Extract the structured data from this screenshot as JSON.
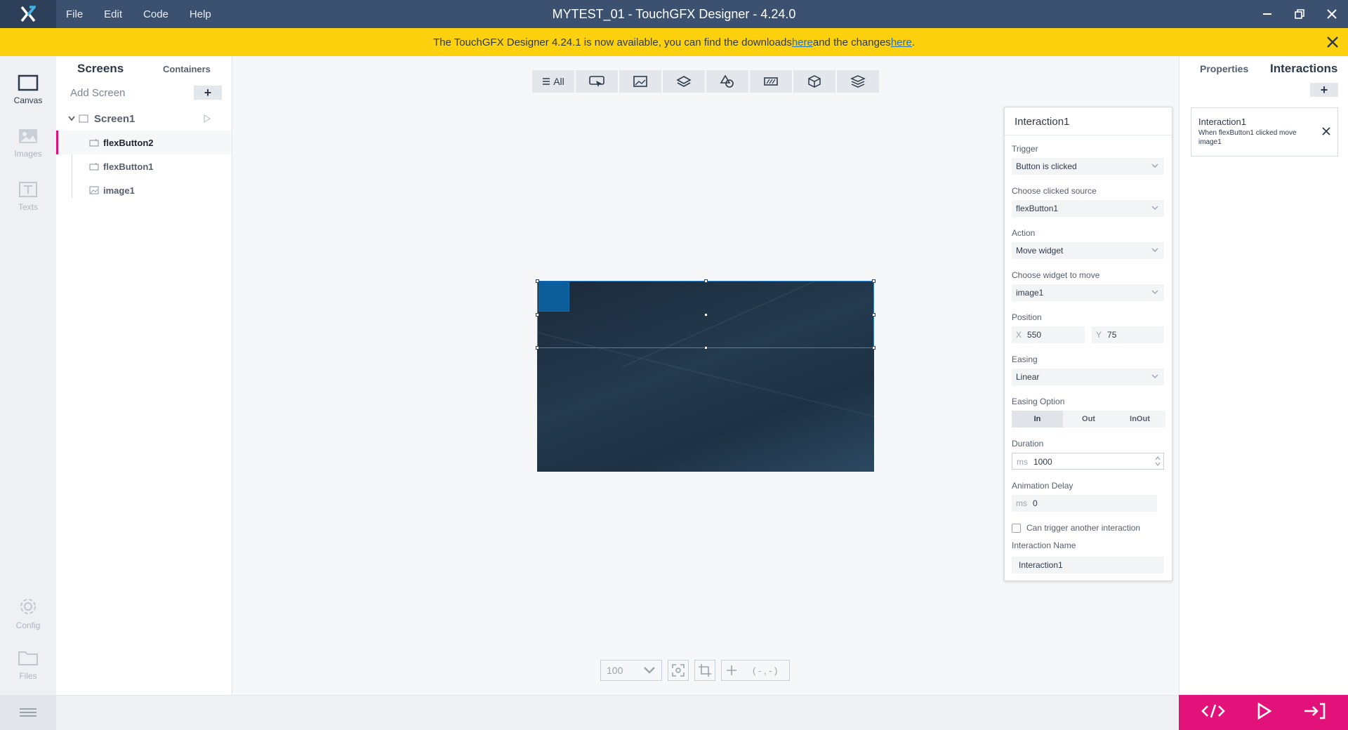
{
  "window": {
    "title": "MYTEST_01 - TouchGFX Designer - 4.24.0"
  },
  "menu": [
    "File",
    "Edit",
    "Code",
    "Help"
  ],
  "notice": {
    "text_before": "The TouchGFX Designer 4.24.1 is now available, you can find the downloads ",
    "link1": "here",
    "text_middle": " and the changes ",
    "link2": "here",
    "text_after": "."
  },
  "rail": {
    "canvas": "Canvas",
    "images": "Images",
    "texts": "Texts",
    "config": "Config",
    "files": "Files"
  },
  "screens_panel": {
    "tab_screens": "Screens",
    "tab_containers": "Containers",
    "add_screen": "Add Screen",
    "add_symbol": "+",
    "screen_name": "Screen1",
    "widgets": [
      "flexButton2",
      "flexButton1",
      "image1"
    ]
  },
  "toolbar": {
    "all_label": "All"
  },
  "zoom": {
    "level": "100",
    "coords": "( - , - )"
  },
  "interaction_detail": {
    "title": "Interaction1",
    "trigger_label": "Trigger",
    "trigger_value": "Button is clicked",
    "source_label": "Choose clicked source",
    "source_value": "flexButton1",
    "action_label": "Action",
    "action_value": "Move widget",
    "widget_label": "Choose widget to move",
    "widget_value": "image1",
    "position_label": "Position",
    "x_prefix": "X",
    "x_value": "550",
    "y_prefix": "Y",
    "y_value": "75",
    "easing_label": "Easing",
    "easing_value": "Linear",
    "easing_option_label": "Easing Option",
    "easing_options": [
      "In",
      "Out",
      "InOut"
    ],
    "duration_label": "Duration",
    "duration_unit": "ms",
    "duration_value": "1000",
    "delay_label": "Animation Delay",
    "delay_unit": "ms",
    "delay_value": "0",
    "chain_label": "Can trigger another interaction",
    "name_label": "Interaction Name",
    "name_value": "Interaction1"
  },
  "right_panel": {
    "tab_properties": "Properties",
    "tab_interactions": "Interactions",
    "add_symbol": "+",
    "card_name": "Interaction1",
    "card_desc": "When flexButton1 clicked move image1"
  },
  "colors": {
    "accent": "#e2127a",
    "titlebar": "#3c5070",
    "notice": "#fdd10d",
    "selection": "#2f8ad6"
  }
}
